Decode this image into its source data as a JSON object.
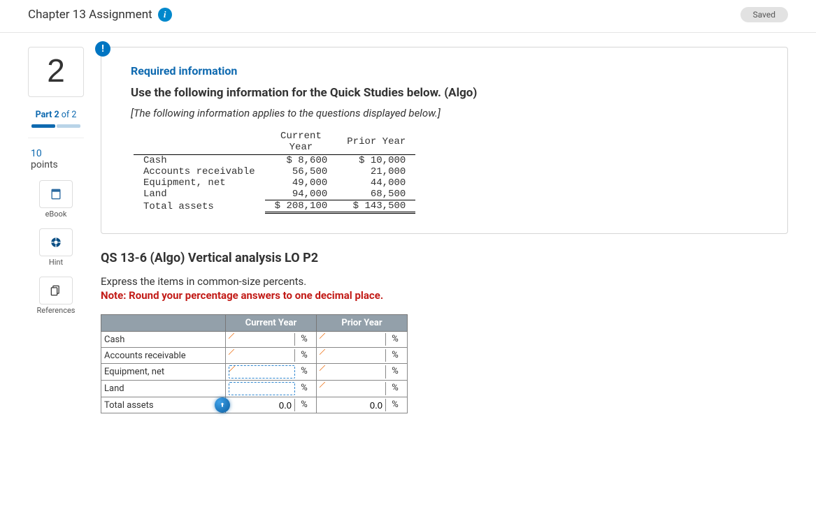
{
  "header": {
    "title": "Chapter 13 Assignment",
    "saved_label": "Saved"
  },
  "sidebar": {
    "question_number": "2",
    "part_prefix": "Part ",
    "part_current": "2",
    "part_of_word": " of ",
    "part_total": "2",
    "points_value": "10",
    "points_label": "points",
    "tools": [
      {
        "label": "eBook"
      },
      {
        "label": "Hint"
      },
      {
        "label": "References"
      }
    ]
  },
  "card": {
    "req_info": "Required information",
    "use_following": "Use the following information for the Quick Studies below. (Algo)",
    "applies": "[The following information applies to the questions displayed below.]",
    "col_current": "Current\nYear",
    "col_prior": "Prior Year",
    "rows": [
      {
        "label": "Cash",
        "cur": "$ 8,600",
        "pri": "$ 10,000"
      },
      {
        "label": "Accounts receivable",
        "cur": "56,500",
        "pri": "21,000"
      },
      {
        "label": "Equipment, net",
        "cur": "49,000",
        "pri": "44,000"
      },
      {
        "label": "Land",
        "cur": "94,000",
        "pri": "68,500"
      }
    ],
    "total_label": "Total assets",
    "total_cur": "$ 208,100",
    "total_pri": "$ 143,500"
  },
  "question": {
    "title": "QS 13-6 (Algo) Vertical analysis LO P2",
    "express": "Express the items in common-size percents.",
    "note": "Note: Round your percentage answers to one decimal place.",
    "col_current": "Current Year",
    "col_prior": "Prior Year",
    "unit": "%",
    "rows": [
      {
        "label": "Cash"
      },
      {
        "label": "Accounts receivable"
      },
      {
        "label": "Equipment, net"
      },
      {
        "label": "Land"
      }
    ],
    "total_label": "Total assets",
    "total_current_value": "0.0",
    "total_prior_value": "0.0"
  }
}
